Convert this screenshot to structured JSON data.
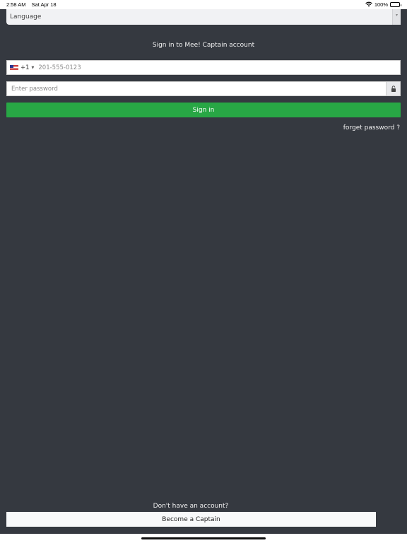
{
  "status_bar": {
    "time": "2:58 AM",
    "date": "Sat Apr 18",
    "battery": "100%",
    "battery_level": 1.0
  },
  "form": {
    "language_placeholder": "Language",
    "title": "Sign in to Mee! Captain account",
    "phone": {
      "country_flag": "us-flag-icon",
      "dial_code": "+1",
      "placeholder": "201-555-0123"
    },
    "password": {
      "placeholder": "Enter password",
      "icon": "lock-icon"
    },
    "signin_label": "Sign in",
    "forget_label": "forget password ?"
  },
  "footer": {
    "no_account_text": "Don't have an account?",
    "become_captain_label": "Become a Captain"
  },
  "colors": {
    "background": "#353940",
    "primary": "#28a745",
    "text_light": "#f2f2f2"
  }
}
